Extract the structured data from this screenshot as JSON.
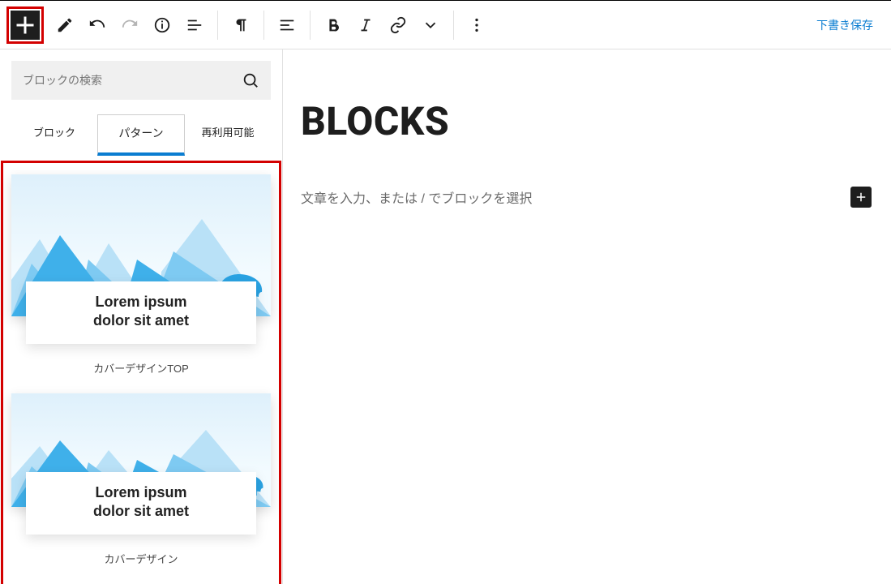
{
  "toolbar": {
    "save_draft": "下書き保存"
  },
  "sidebar": {
    "search": {
      "placeholder": "ブロックの検索"
    },
    "tabs": [
      {
        "label": "ブロック"
      },
      {
        "label": "パターン"
      },
      {
        "label": "再利用可能"
      }
    ],
    "patterns": [
      {
        "headline": "Lorem ipsum\ndolor sit amet",
        "caption": "カバーデザインTOP"
      },
      {
        "headline": "Lorem ipsum\ndolor sit amet",
        "caption": "カバーデザイン"
      }
    ]
  },
  "editor": {
    "title": "BLOCKS",
    "placeholder": "文章を入力、または / でブロックを選択"
  }
}
